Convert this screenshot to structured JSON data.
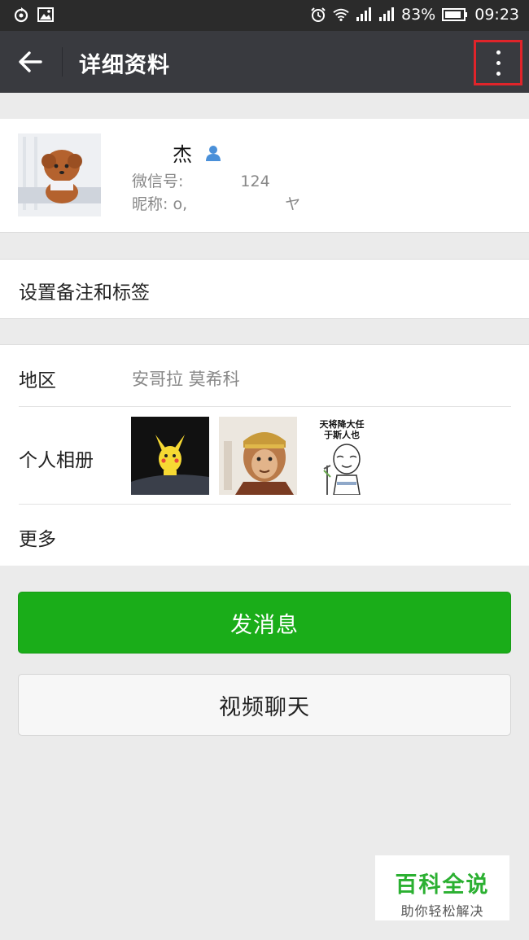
{
  "status_bar": {
    "battery": "83%",
    "time": "09:23",
    "icons": [
      "sync-icon",
      "image-icon",
      "alarm-icon",
      "wifi-icon",
      "signal-icon",
      "signal-icon",
      "battery-icon"
    ]
  },
  "nav": {
    "title": "详细资料",
    "back_icon": "arrow-left-icon",
    "menu_icon": "more-vertical-icon"
  },
  "profile": {
    "name": "杰",
    "wechat_id_label": "微信号:",
    "wechat_id_value": "124",
    "nickname_label": "昵称: o,",
    "nickname_value": "ヤ"
  },
  "remark": {
    "label": "设置备注和标签"
  },
  "details": {
    "region_label": "地区",
    "region_value": "安哥拉  莫希科",
    "album_label": "个人相册",
    "album_photo3_text_line1": "天将降大任",
    "album_photo3_text_line2": "于斯人也",
    "more_label": "更多"
  },
  "actions": {
    "send_message": "发消息",
    "video_chat": "视频聊天"
  },
  "watermark": {
    "title": "百科全说",
    "subtitle": "助你轻松解决"
  },
  "colors": {
    "nav_bg": "#393a3f",
    "status_bg": "#2b2b2b",
    "primary_green": "#1aad19",
    "highlight_red": "#e0242a",
    "watermark_green": "#2bb031"
  }
}
